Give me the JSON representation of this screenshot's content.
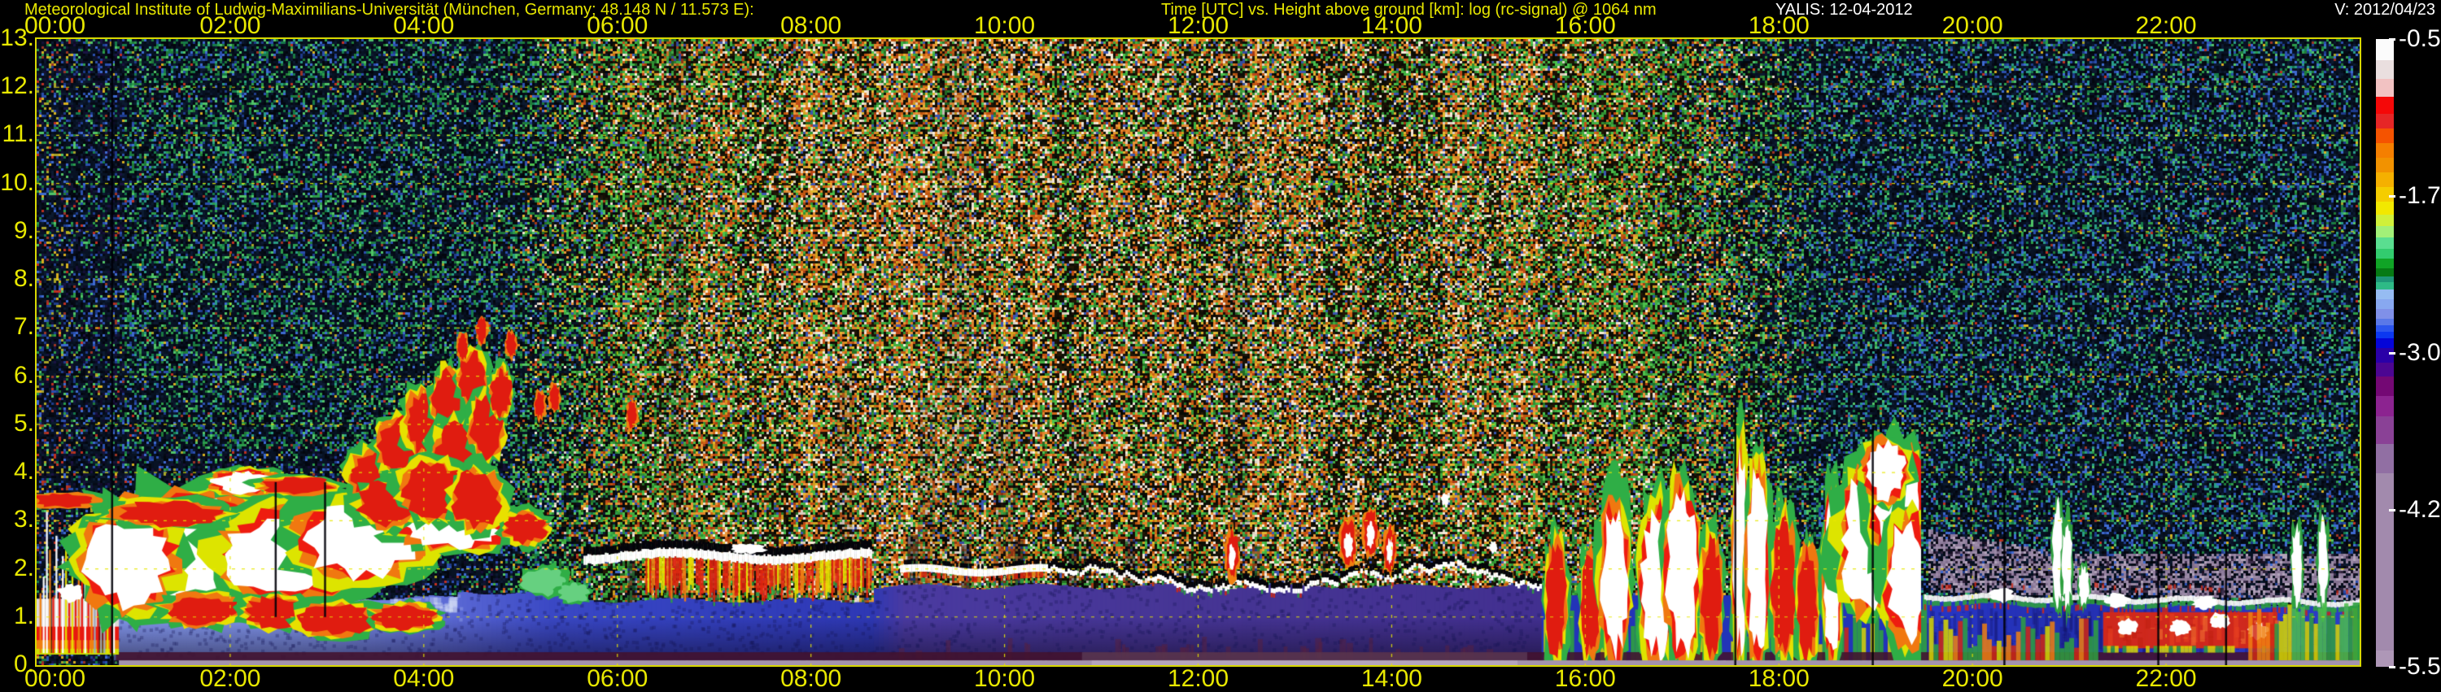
{
  "header": {
    "left_title": "Meteorological Institute of Ludwig-Maximilians-Universität (München, Germany; 48.148 N / 11.573 E):",
    "center_title": "Time [UTC] vs. Height above ground [km]: log (rc-signal) @ 1064 nm",
    "station_date": "YALIS: 12-04-2012",
    "version": "V: 2012/04/23"
  },
  "chart_data": {
    "type": "heatmap",
    "title": "Time [UTC] vs. Height above ground [km]: log (rc-signal) @ 1064 nm",
    "xlabel": "Time [UTC]",
    "ylabel": "Height above ground [km]",
    "x_axis": {
      "range_hours": [
        0,
        24
      ],
      "tick_hours": [
        0,
        2,
        4,
        6,
        8,
        10,
        12,
        14,
        16,
        18,
        20,
        22
      ],
      "tick_labels": [
        "00:00",
        "02:00",
        "04:00",
        "06:00",
        "08:00",
        "10:00",
        "12:00",
        "14:00",
        "16:00",
        "18:00",
        "20:00",
        "22:00"
      ]
    },
    "y_axis": {
      "range_km": [
        0,
        13
      ],
      "tick_km": [
        13,
        12,
        11,
        10,
        9,
        8,
        7,
        6,
        5,
        4,
        3,
        2,
        1,
        0
      ],
      "tick_labels": [
        "13.",
        "12.",
        "11.",
        "10.",
        "9.",
        "8.",
        "7.",
        "6.",
        "5.",
        "4.",
        "3.",
        "2.",
        "1.",
        "0."
      ]
    },
    "grid": {
      "color": "#e8e800",
      "style": "dashed",
      "x_step_hours": 2,
      "y_step_km": 1
    },
    "colorbar": {
      "quantity": "log (rc-signal) @ 1064 nm",
      "tick_labels": [
        "-0.50",
        "-1.75",
        "-3.00",
        "-4.25",
        "-5.50"
      ],
      "tick_values": [
        -0.5,
        -1.75,
        -3.0,
        -4.25,
        -5.5
      ],
      "bands": [
        [
          "#fcfcfc",
          26
        ],
        [
          "#eadfdf",
          23
        ],
        [
          "#f2c2c2",
          22
        ],
        [
          "#f50808",
          21
        ],
        [
          "#e62626",
          18
        ],
        [
          "#f55300",
          18
        ],
        [
          "#f57f00",
          18
        ],
        [
          "#f29200",
          18
        ],
        [
          "#f5b000",
          18
        ],
        [
          "#f5cd00",
          18
        ],
        [
          "#f2e800",
          16
        ],
        [
          "#d0f03a",
          14
        ],
        [
          "#a2f078",
          14
        ],
        [
          "#5ade90",
          14
        ],
        [
          "#32cc6e",
          12
        ],
        [
          "#10a426",
          12
        ],
        [
          "#067a14",
          10
        ],
        [
          "#1e9678",
          7
        ],
        [
          "#2eba86",
          9
        ],
        [
          "#96bcf2",
          12
        ],
        [
          "#88a8f0",
          12
        ],
        [
          "#8090e8",
          12
        ],
        [
          "#5a78e8",
          8
        ],
        [
          "#2c55ee",
          8
        ],
        [
          "#0c38f0",
          8
        ],
        [
          "#0505d8",
          12
        ],
        [
          "#2a00a8",
          18
        ],
        [
          "#4c0692",
          17
        ],
        [
          "#740874",
          24
        ],
        [
          "#8c2390",
          25
        ],
        [
          "#8a4196",
          34
        ],
        [
          "#916fa3",
          36
        ],
        [
          "#a28aad",
          218
        ],
        [
          "#ae97b7",
          20
        ]
      ]
    },
    "palettes": {
      "dayWhite": [
        "#efe2d2",
        "#f7ecd9",
        "#d9cec0"
      ],
      "dayOrange": [
        "#d06616",
        "#e2832a",
        "#c05510",
        "#e8953a"
      ],
      "dayRed": [
        "#a83a14",
        "#c04818"
      ],
      "dayYellow": [
        "#cfa01e",
        "#e0b830"
      ],
      "dayGreen": [
        "#2f8f33",
        "#3fae3f",
        "#256f25",
        "#4cc04c"
      ],
      "dayBlue": [
        "#3a55b0"
      ],
      "dayDark": [
        "#140d04",
        "#1c1308",
        "#0c1006",
        "#221706",
        "#080a04"
      ],
      "nightGreen": [
        "#2d9c4a",
        "#1f7a38",
        "#52c468",
        "#167a4a"
      ],
      "nightBlue": [
        "#2b4fae",
        "#3e6ad0",
        "#1e3c8c"
      ],
      "nightTeal": [
        "#2a9c86"
      ],
      "nightWarm": [
        "#a8a428",
        "#9c3424",
        "#c03020",
        "#d8b020"
      ],
      "nightDark": [
        "#050b16",
        "#081224",
        "#0c1a30",
        "#03060e",
        "#061020"
      ],
      "purpleDark": [
        "#150f36",
        "#1a1242",
        "#0f0a28"
      ],
      "mauve": [
        "#8f7d9c",
        "#9b8aa6",
        "#83718f"
      ],
      "mauveLight": [
        "#b2a4ba"
      ],
      "mauveDark": [
        "#2c2038",
        "#3a2c48",
        "#191022"
      ]
    },
    "fringes": {
      "full": [
        [
          "#2fae46",
          1.5
        ],
        [
          "#dde400",
          1.3
        ],
        [
          "#f07810",
          1.16
        ],
        [
          "#ee1c10",
          1.07
        ],
        [
          "#ffffff",
          1.0
        ]
      ],
      "warm": [
        [
          "#2fae46",
          1.42
        ],
        [
          "#e8e000",
          1.22
        ],
        [
          "#f07810",
          1.1
        ],
        [
          "#e01c10",
          1.0
        ]
      ],
      "red": [
        [
          "#f08010",
          1.25
        ],
        [
          "#e01c10",
          1.0
        ]
      ],
      "green": [
        [
          "#2fae46",
          1.25
        ],
        [
          "#66d080",
          1.0
        ]
      ]
    },
    "features": {
      "noise": {
        "sunrise": [
          4.7,
          6.3
        ],
        "sunset": [
          16.6,
          18.4
        ],
        "orange_ramp": [
          6.2,
          7.9,
          14.3,
          16.6
        ]
      },
      "shadows": [
        [
          6.15,
          0.08,
          2.2,
          0.5
        ],
        [
          6.55,
          0.06,
          2.3,
          0.45
        ],
        [
          7.0,
          0.1,
          2.4,
          0.5
        ],
        [
          7.65,
          0.07,
          2.2,
          0.4
        ],
        [
          8.2,
          0.06,
          2.5,
          0.45
        ],
        [
          8.55,
          0.05,
          2.6,
          0.4
        ],
        [
          9.05,
          0.12,
          2.7,
          0.5
        ],
        [
          9.6,
          0.1,
          2.5,
          0.45
        ],
        [
          10.15,
          0.09,
          2.6,
          0.5
        ],
        [
          10.7,
          0.08,
          2.4,
          0.4
        ],
        [
          11.3,
          0.1,
          2.6,
          0.45
        ],
        [
          11.9,
          0.07,
          2.3,
          0.4
        ],
        [
          12.6,
          0.08,
          2.5,
          0.35
        ],
        [
          13.3,
          0.06,
          2.4,
          0.35
        ],
        [
          8.35,
          0.18,
          6.0,
          0.18
        ],
        [
          9.2,
          0.2,
          5.5,
          0.15
        ],
        [
          10.0,
          0.22,
          6.2,
          0.18
        ],
        [
          10.8,
          0.2,
          5.0,
          0.15
        ],
        [
          6.6,
          0.25,
          13,
          0.12
        ],
        [
          9.5,
          0.3,
          13,
          0.1
        ],
        [
          12.4,
          0.25,
          13,
          0.1
        ]
      ],
      "sub_region": {
        "t0": 0.8,
        "t1": 15.55,
        "top_steps": [
          [
            4.3,
            1.38
          ],
          [
            5.6,
            1.5
          ],
          [
            8.62,
            1.33
          ],
          [
            99,
            1.62
          ]
        ],
        "stops": [
          [
            0.8,
            "#8296ea"
          ],
          [
            3.0,
            "#7e92e8"
          ],
          [
            4.3,
            "#5a68d4"
          ],
          [
            5.3,
            "#3a48c4"
          ],
          [
            6.0,
            "#3644c2"
          ],
          [
            8.6,
            "#2e38b4"
          ],
          [
            8.95,
            "#4a3aa0"
          ],
          [
            12.0,
            "#463594"
          ],
          [
            15.55,
            "#423090"
          ]
        ]
      },
      "eve_region": {
        "t0": 19.5,
        "t1": 24,
        "stops": [
          [
            19.5,
            "#2836c6"
          ],
          [
            21.0,
            "#2330b0"
          ],
          [
            22.2,
            "#2834bc"
          ],
          [
            24,
            "#2c3cc8"
          ]
        ]
      },
      "cloud_blobs": [
        [
          1.55,
          2.45,
          0.8,
          1.0,
          "full"
        ],
        [
          2.6,
          2.3,
          0.62,
          0.8,
          "full"
        ],
        [
          3.35,
          2.6,
          0.55,
          0.75,
          "full"
        ],
        [
          4.3,
          2.85,
          0.5,
          0.4,
          "full"
        ],
        [
          0.95,
          2.2,
          0.42,
          0.9,
          "full"
        ],
        [
          1.35,
          3.15,
          0.5,
          0.25,
          "warm"
        ],
        [
          2.15,
          3.8,
          0.3,
          0.22,
          "full"
        ],
        [
          2.7,
          3.72,
          0.35,
          0.18,
          "warm"
        ],
        [
          3.5,
          3.95,
          0.25,
          0.5,
          "warm"
        ],
        [
          3.75,
          4.55,
          0.2,
          0.55,
          "warm"
        ],
        [
          4.0,
          5.05,
          0.18,
          0.6,
          "warm"
        ],
        [
          4.25,
          5.55,
          0.15,
          0.55,
          "warm"
        ],
        [
          4.5,
          5.95,
          0.13,
          0.5,
          "warm"
        ],
        [
          4.35,
          4.35,
          0.22,
          0.65,
          "warm"
        ],
        [
          4.65,
          4.95,
          0.16,
          0.6,
          "warm"
        ],
        [
          4.8,
          5.65,
          0.1,
          0.45,
          "warm"
        ],
        [
          3.65,
          3.35,
          0.3,
          0.45,
          "warm"
        ],
        [
          4.1,
          3.65,
          0.3,
          0.55,
          "warm"
        ],
        [
          4.55,
          3.45,
          0.24,
          0.55,
          "warm"
        ],
        [
          5.05,
          2.85,
          0.2,
          0.3,
          "warm"
        ],
        [
          0.28,
          3.42,
          0.3,
          0.14,
          "red"
        ],
        [
          1.7,
          1.15,
          0.35,
          0.3,
          "warm"
        ],
        [
          2.45,
          1.1,
          0.3,
          0.3,
          "warm"
        ],
        [
          3.1,
          0.95,
          0.35,
          0.3,
          "warm"
        ],
        [
          3.8,
          1.0,
          0.3,
          0.25,
          "warm"
        ],
        [
          5.25,
          1.75,
          0.22,
          0.28,
          "green"
        ],
        [
          5.55,
          1.5,
          0.15,
          0.2,
          "green"
        ]
      ],
      "cloud_specks": [
        [
          4.4,
          6.6
        ],
        [
          4.6,
          6.95
        ],
        [
          4.9,
          6.65
        ],
        [
          5.2,
          5.4
        ],
        [
          5.35,
          5.55
        ],
        [
          6.15,
          5.2
        ]
      ],
      "left_stack": {
        "bands": [
          [
            0.0,
            0.85,
            0.78,
            1.38,
            "#ded6d6"
          ],
          [
            0.0,
            0.85,
            0.48,
            0.8,
            "#e81810"
          ],
          [
            0.0,
            0.85,
            0.3,
            0.52,
            "#f08010"
          ],
          [
            0.0,
            0.85,
            0.22,
            0.34,
            "#cfe000"
          ]
        ],
        "streak_range": [
          0.03,
          0.82
        ],
        "streak_top": [
          1.25,
          3.35
        ]
      },
      "midday": {
        "segA": [
          5.65,
          8.62
        ],
        "drips": [
          6.25,
          8.62
        ],
        "segB": [
          8.92,
          10.45
        ],
        "segC": [
          10.45,
          15.55
        ],
        "towers": [
          [
            12.35,
            2.6,
            0.06
          ],
          [
            13.55,
            2.85,
            0.08
          ],
          [
            13.78,
            3.05,
            0.07
          ],
          [
            13.98,
            2.7,
            0.06
          ]
        ],
        "dots": [
          [
            14.55,
            3.45
          ],
          [
            15.05,
            2.45
          ]
        ]
      },
      "convection": {
        "range": [
          15.55,
          19.5
        ],
        "towers": [
          [
            15.7,
            2.45,
            0.1
          ],
          [
            16.05,
            2.2,
            0.09
          ],
          [
            16.3,
            3.2,
            0.13
          ],
          [
            16.75,
            3.1,
            0.16
          ],
          [
            17.0,
            3.5,
            0.15
          ],
          [
            17.3,
            2.6,
            0.1
          ],
          [
            17.6,
            4.2,
            0.07
          ],
          [
            17.78,
            3.85,
            0.1
          ],
          [
            18.05,
            2.9,
            0.12
          ],
          [
            18.3,
            2.35,
            0.1
          ],
          [
            18.55,
            3.3,
            0.08
          ]
        ],
        "big_mass": {
          "cutoff": 19.47,
          "blobs": [
            [
              18.95,
              2.6,
              0.3,
              1.3
            ],
            [
              19.25,
              3.2,
              0.25,
              1.1
            ],
            [
              19.34,
              1.8,
              0.22,
              1.15
            ],
            [
              19.1,
              4.05,
              0.2,
              0.55
            ]
          ]
        }
      },
      "evening": {
        "layer_start": 19.5,
        "red_region": [
          21.35,
          23.15,
          0.35,
          1.1
        ],
        "white_patches": [
          [
            21.6,
            0.8
          ],
          [
            22.15,
            0.78
          ],
          [
            22.55,
            0.92
          ],
          [
            22.95,
            0.7
          ]
        ],
        "layer_bright": [
          [
            20.3,
            1.45
          ],
          [
            21.5,
            1.35
          ],
          [
            22.4,
            1.3
          ]
        ],
        "towers": [
          [
            20.88,
            3.3
          ],
          [
            20.98,
            2.9
          ],
          [
            21.15,
            2.05
          ],
          [
            23.35,
            2.85
          ],
          [
            23.62,
            3.0
          ]
        ]
      },
      "black_lines": [
        [
          0.78,
          0,
          13
        ],
        [
          2.47,
          1.0,
          3.8
        ],
        [
          2.98,
          1.0,
          3.8
        ],
        [
          17.55,
          0,
          5.5
        ],
        [
          18.97,
          0,
          5.0
        ],
        [
          20.33,
          0,
          4.0
        ],
        [
          21.92,
          0,
          2.5
        ],
        [
          22.62,
          0,
          2.5
        ]
      ]
    }
  }
}
